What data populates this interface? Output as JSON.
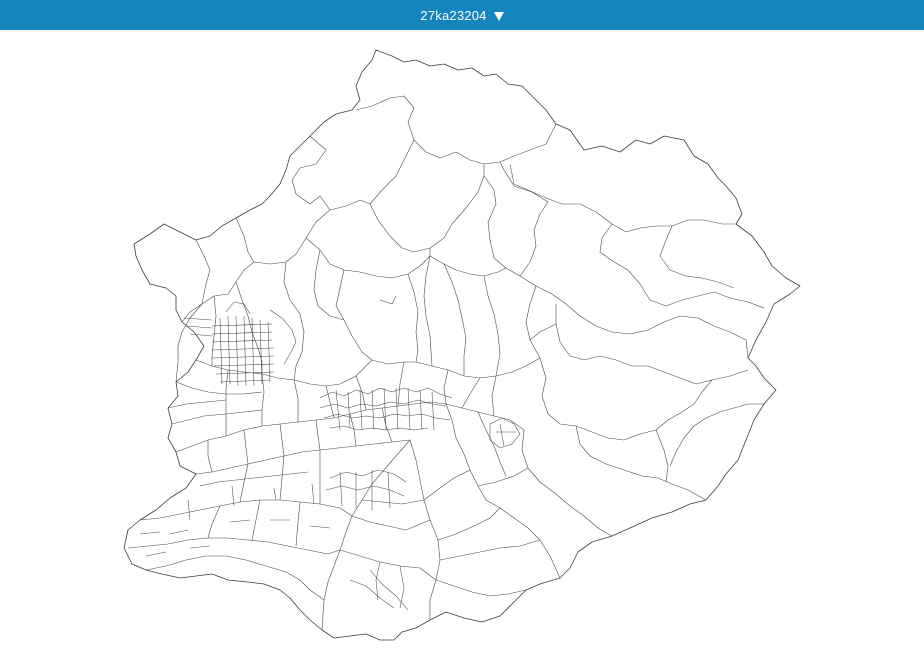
{
  "header": {
    "area_code": "27ka23204"
  },
  "icons": {
    "dropdown": "caret-down-icon"
  },
  "colors": {
    "header_bg": "#1486bd",
    "header_text": "#ffffff",
    "map_stroke": "#3c3c3c",
    "map_fill": "#ffffff",
    "page_bg": "#ffffff"
  }
}
